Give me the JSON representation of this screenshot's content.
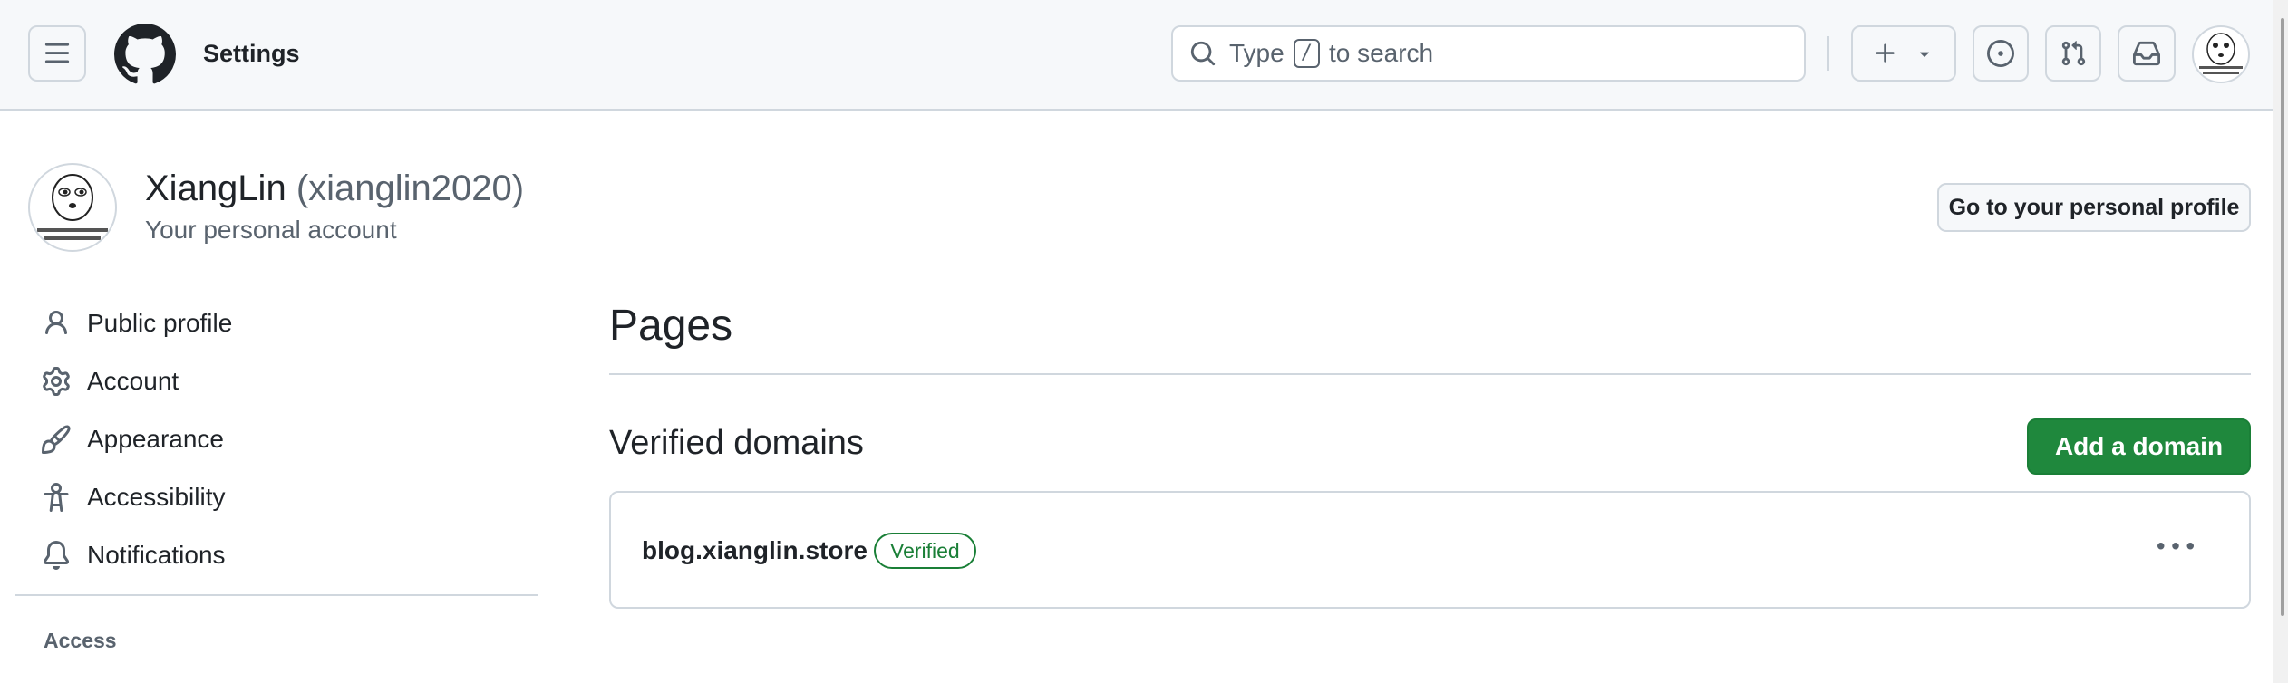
{
  "header": {
    "title": "Settings",
    "search": {
      "before": "Type",
      "key": "/",
      "after": "to search"
    },
    "icons": [
      "hamburger-icon",
      "github-logo",
      "search-icon",
      "plus-icon",
      "triangle-down-icon",
      "issue-icon",
      "pull-request-icon",
      "inbox-icon"
    ]
  },
  "account": {
    "name": "XiangLin",
    "handle": "(xianglin2020)",
    "subtitle": "Your personal account",
    "go_profile_label": "Go to your personal profile"
  },
  "sidebar": {
    "items": [
      {
        "label": "Public profile",
        "icon": "person-icon"
      },
      {
        "label": "Account",
        "icon": "gear-icon"
      },
      {
        "label": "Appearance",
        "icon": "paintbrush-icon"
      },
      {
        "label": "Accessibility",
        "icon": "accessibility-icon"
      },
      {
        "label": "Notifications",
        "icon": "bell-icon"
      }
    ],
    "section_label": "Access"
  },
  "main": {
    "heading": "Pages",
    "section_heading": "Verified domains",
    "add_button_label": "Add a domain",
    "domains": [
      {
        "name": "blog.xianglin.store",
        "status": "Verified"
      }
    ]
  },
  "colors": {
    "primary_green": "#1f883d",
    "verified_green": "#1a7f37",
    "border": "#d0d7de",
    "muted_text": "#59636e",
    "header_bg": "#f6f8fa"
  }
}
